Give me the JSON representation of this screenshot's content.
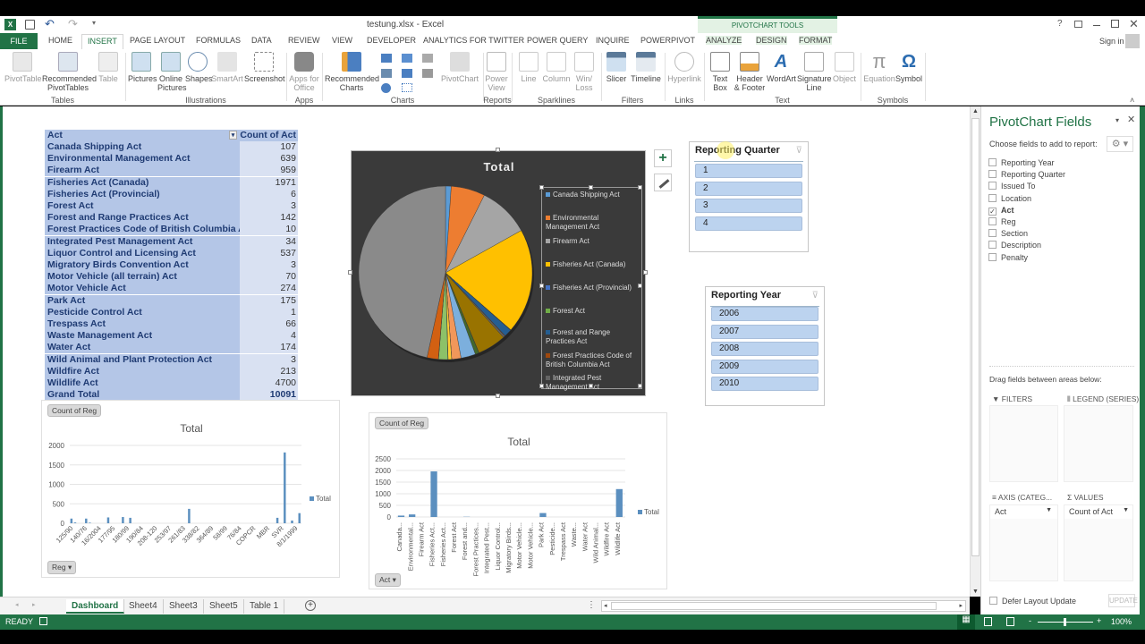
{
  "window": {
    "title": "testung.xlsx - Excel",
    "help": "?",
    "sign_in": "Sign in",
    "context_tab_group": "PIVOTCHART TOOLS"
  },
  "qat": {
    "undo": "↶",
    "redo": "↷"
  },
  "tabs": [
    "FILE",
    "HOME",
    "INSERT",
    "PAGE LAYOUT",
    "FORMULAS",
    "DATA",
    "REVIEW",
    "VIEW",
    "DEVELOPER",
    "ANALYTICS FOR TWITTER",
    "POWER QUERY",
    "INQUIRE",
    "POWERPIVOT",
    "ANALYZE",
    "DESIGN",
    "FORMAT"
  ],
  "active_tab": "INSERT",
  "ribbon": {
    "buttons": {
      "pivottable": "PivotTable",
      "recommended_pivottables": [
        "Recommended",
        "PivotTables"
      ],
      "table": "Table",
      "pictures": "Pictures",
      "online_pictures": [
        "Online",
        "Pictures"
      ],
      "shapes": "Shapes",
      "smartart": "SmartArt",
      "screenshot": "Screenshot",
      "apps_for_office": [
        "Apps for",
        "Office"
      ],
      "recommended_charts": [
        "Recommended",
        "Charts"
      ],
      "pivotchart": "PivotChart",
      "power_view": [
        "Power",
        "View"
      ],
      "line": "Line",
      "column": "Column",
      "winloss": [
        "Win/",
        "Loss"
      ],
      "slicer": "Slicer",
      "timeline": "Timeline",
      "hyperlink": "Hyperlink",
      "text_box": [
        "Text",
        "Box"
      ],
      "header_footer": [
        "Header",
        "& Footer"
      ],
      "wordart": "WordArt",
      "signature_line": [
        "Signature",
        "Line"
      ],
      "object": "Object",
      "equation": "Equation",
      "symbol": "Symbol"
    },
    "groups": [
      "Tables",
      "Illustrations",
      "Apps",
      "Charts",
      "Reports",
      "Sparklines",
      "Filters",
      "Links",
      "Text",
      "Symbols"
    ]
  },
  "pivot_table": {
    "header_act": "Act",
    "header_count": "Count of Act",
    "rows": [
      {
        "act": "Canada Shipping Act",
        "count": "107"
      },
      {
        "act": "Environmental Management Act",
        "count": "639"
      },
      {
        "act": "Firearm Act",
        "count": "959"
      },
      {
        "act": "Fisheries Act (Canada)",
        "count": "1971"
      },
      {
        "act": "Fisheries Act (Provincial)",
        "count": "6"
      },
      {
        "act": "Forest Act",
        "count": "3"
      },
      {
        "act": "Forest and Range Practices Act",
        "count": "142"
      },
      {
        "act": "Forest Practices Code of British Columbia Act",
        "count": "10"
      },
      {
        "act": "Integrated Pest Management Act",
        "count": "34"
      },
      {
        "act": "Liquor Control and Licensing Act",
        "count": "537"
      },
      {
        "act": "Migratory Birds Convention Act",
        "count": "3"
      },
      {
        "act": "Motor Vehicle (all terrain) Act",
        "count": "70"
      },
      {
        "act": "Motor Vehicle Act",
        "count": "274"
      },
      {
        "act": "Park Act",
        "count": "175"
      },
      {
        "act": "Pesticide Control Act",
        "count": "1"
      },
      {
        "act": "Trespass Act",
        "count": "66"
      },
      {
        "act": "Waste Management Act",
        "count": "4"
      },
      {
        "act": "Water Act",
        "count": "174"
      },
      {
        "act": "Wild Animal and Plant Protection Act",
        "count": "3"
      },
      {
        "act": "Wildfire Act",
        "count": "213"
      },
      {
        "act": "Wildlife Act",
        "count": "4700"
      }
    ],
    "grand_total_label": "Grand Total",
    "grand_total": "10091"
  },
  "chart_data": [
    {
      "type": "pie",
      "title": "Total",
      "legend_position": "right",
      "legend": [
        "Canada Shipping Act",
        "Environmental Management Act",
        "Firearm Act",
        "Fisheries Act (Canada)",
        "Fisheries Act (Provincial)",
        "Forest Act",
        "Forest and Range Practices Act",
        "Forest Practices Code of British Columbia Act",
        "Integrated Pest Management Act"
      ],
      "categories": [
        "Canada Shipping Act",
        "Environmental Management Act",
        "Firearm Act",
        "Fisheries Act (Canada)",
        "Fisheries Act (Provincial)",
        "Forest Act",
        "Forest and Range Practices Act",
        "Forest Practices Code of British Columbia Act",
        "Integrated Pest Management Act",
        "Liquor Control and Licensing Act",
        "Migratory Birds Convention Act",
        "Motor Vehicle (all terrain) Act",
        "Motor Vehicle Act",
        "Park Act",
        "Pesticide Control Act",
        "Trespass Act",
        "Waste Management Act",
        "Water Act",
        "Wild Animal and Plant Protection Act",
        "Wildfire Act",
        "Wildlife Act"
      ],
      "values": [
        107,
        639,
        959,
        1971,
        6,
        3,
        142,
        10,
        34,
        537,
        3,
        70,
        274,
        175,
        1,
        66,
        4,
        174,
        3,
        213,
        4700
      ],
      "colors": [
        "#5b9bd5",
        "#ed7d31",
        "#a5a5a5",
        "#ffc000",
        "#4472c4",
        "#70ad47",
        "#255e91",
        "#9e480e",
        "#636363",
        "#997300",
        "#264478",
        "#43682b",
        "#7cafdd",
        "#f1975a",
        "#b7b7b7",
        "#ffcd33",
        "#698ed0",
        "#8cc168",
        "#327dc2",
        "#d26012",
        "#8a8a8a"
      ]
    },
    {
      "type": "bar",
      "title": "Total",
      "field_button": "Count of Reg",
      "axis_button": "Reg",
      "legend": [
        "Total"
      ],
      "legend_position": "right",
      "categories": [
        "125/90",
        "",
        "140/76",
        "",
        "16/2004",
        "",
        "177/95",
        "",
        "180/99",
        "",
        "190/84",
        "",
        "208-120",
        "",
        "253/97",
        "",
        "261/83",
        "",
        "338/82",
        "",
        "364/89",
        "",
        "58/99",
        "",
        "76/84",
        "",
        "COPCR",
        "",
        "MBR",
        "",
        "SVR",
        "",
        "8/1/1999"
      ],
      "values": [
        120,
        20,
        0,
        0,
        120,
        15,
        0,
        0,
        0,
        0,
        150,
        0,
        0,
        0,
        160,
        0,
        140,
        0,
        0,
        0,
        0,
        0,
        0,
        0,
        0,
        0,
        0,
        0,
        0,
        0,
        0,
        0,
        370,
        0,
        0,
        0,
        0,
        0,
        0,
        0,
        0,
        0,
        0,
        0,
        0,
        0,
        0,
        0,
        0,
        0,
        0,
        0,
        0,
        0,
        0,
        0,
        140,
        0,
        1820,
        0,
        70,
        0,
        260
      ],
      "ylim": [
        0,
        2000
      ],
      "yticks": [
        0,
        500,
        1000,
        1500,
        2000
      ],
      "grid": true
    },
    {
      "type": "bar",
      "title": "Total",
      "field_button": "Count of Reg",
      "axis_button": "Act",
      "legend": [
        "Total"
      ],
      "legend_position": "right",
      "categories": [
        "Canada...",
        "Environmental...",
        "Firearm Act",
        "Fisheries Act...",
        "Fisheries Act...",
        "Forest Act",
        "Forest and...",
        "Forest Practices...",
        "Integrated Pest...",
        "Liquor Control...",
        "Migratory Birds...",
        "Motor Vehicle...",
        "Motor Vehicle...",
        "Park Act",
        "Pesticide...",
        "Trespass Act",
        "Waste...",
        "Water Act",
        "Wild Animal...",
        "Wildfire Act",
        "Wildlife Act"
      ],
      "values": [
        60,
        110,
        0,
        1960,
        0,
        0,
        10,
        0,
        0,
        0,
        0,
        0,
        0,
        170,
        0,
        0,
        0,
        0,
        0,
        0,
        1200
      ],
      "ylim": [
        0,
        2500
      ],
      "yticks": [
        0,
        500,
        1000,
        1500,
        2000,
        2500
      ],
      "grid": true
    }
  ],
  "slicers": {
    "quarter": {
      "title": "Reporting Quarter",
      "items": [
        "1",
        "2",
        "3",
        "4"
      ]
    },
    "year": {
      "title": "Reporting Year",
      "items": [
        "2006",
        "2007",
        "2008",
        "2009",
        "2010"
      ]
    }
  },
  "chart_tools": {
    "add_element": "+",
    "style": "brush"
  },
  "panel": {
    "title": "PivotChart Fields",
    "choose_label": "Choose fields to add to report:",
    "fields": [
      {
        "name": "Reporting Year",
        "checked": false
      },
      {
        "name": "Reporting Quarter",
        "checked": false
      },
      {
        "name": "Issued To",
        "checked": false
      },
      {
        "name": "Location",
        "checked": false
      },
      {
        "name": "Act",
        "checked": true
      },
      {
        "name": "Reg",
        "checked": false
      },
      {
        "name": "Section",
        "checked": false
      },
      {
        "name": "Description",
        "checked": false
      },
      {
        "name": "Penalty",
        "checked": false
      }
    ],
    "drag_label": "Drag fields between areas below:",
    "filters_label": "FILTERS",
    "legend_label": "LEGEND (SERIES)",
    "axis_label": "AXIS (CATEG...",
    "values_label": "VALUES",
    "axis_value": "Act",
    "values_value": "Count of Act",
    "defer_label": "Defer Layout Update",
    "update_label": "UPDATE"
  },
  "sheet_tabs": [
    "Dashboard",
    "Sheet4",
    "Sheet3",
    "Sheet5",
    "Table 1"
  ],
  "active_sheet": "Dashboard",
  "status": {
    "ready": "READY",
    "zoom": "100%"
  }
}
